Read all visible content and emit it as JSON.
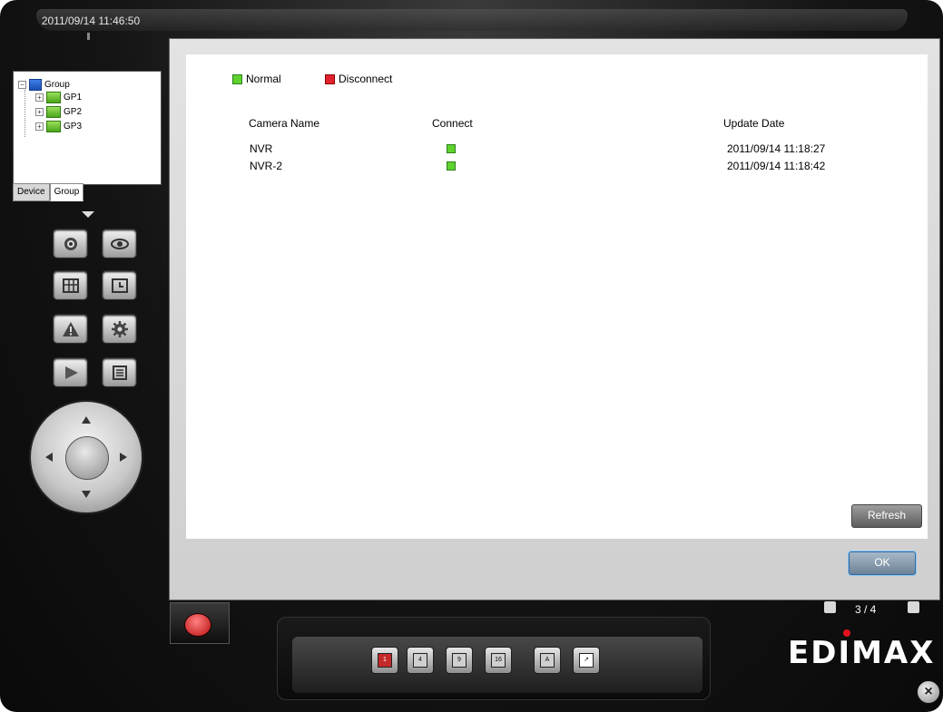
{
  "window": {
    "datetime": "2011/09/14 11:46:50"
  },
  "tree": {
    "root_label": "Group",
    "items": [
      {
        "label": "GP1"
      },
      {
        "label": "GP2"
      },
      {
        "label": "GP3"
      }
    ],
    "tabs": [
      {
        "label": "Device",
        "active": false
      },
      {
        "label": "Group",
        "active": true
      }
    ]
  },
  "legend": {
    "normal_label": "Normal",
    "disconnect_label": "Disconnect",
    "normal_color": "#5fd32d",
    "disconnect_color": "#e0222f"
  },
  "table": {
    "headers": [
      "Camera Name",
      "Connect",
      "Update Date"
    ],
    "rows": [
      {
        "name": "NVR",
        "connect": "normal",
        "date": "2011/09/14 11:18:27"
      },
      {
        "name": "NVR-2",
        "connect": "normal",
        "date": "2011/09/14 11:18:42"
      }
    ]
  },
  "buttons": {
    "refresh_label": "Refresh",
    "ok_label": "OK"
  },
  "layout_buttons": [
    {
      "label": "1",
      "icon": "layout-1-icon",
      "active": true
    },
    {
      "label": "4",
      "icon": "layout-4-icon"
    },
    {
      "label": "9",
      "icon": "layout-9-icon"
    },
    {
      "label": "16",
      "icon": "layout-16-icon"
    },
    {
      "label": "A",
      "icon": "auto-sequence-icon"
    },
    {
      "label": "",
      "icon": "fullscreen-icon"
    }
  ],
  "pager": {
    "text": "3 / 4"
  },
  "brand": {
    "logo_text": "EDIMAX",
    "accent_color": "#e3121d"
  }
}
